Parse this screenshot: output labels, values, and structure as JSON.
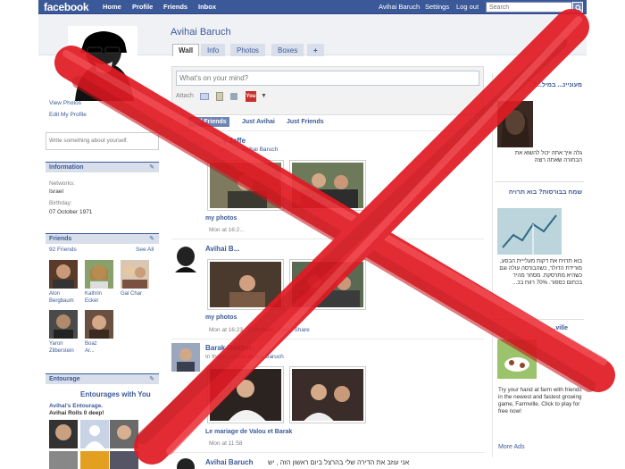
{
  "topbar": {
    "logo": "facebook",
    "nav": [
      "Home",
      "Profile",
      "Friends",
      "Inbox"
    ],
    "user": "Avihai Baruch",
    "settings": "Settings",
    "logout": "Log out",
    "search_placeholder": "Search"
  },
  "left": {
    "view_photos": "View Photos",
    "edit_profile": "Edit My Profile",
    "write_placeholder": "Write something about yourself.",
    "info": {
      "heading": "Information",
      "networks_label": "Networks:",
      "networks_value": "Israel",
      "birthday_label": "Birthday:",
      "birthday_value": "07 October 1971"
    },
    "friends": {
      "heading": "Friends",
      "count": "92 Friends",
      "see_all": "See All",
      "items": [
        {
          "first": "Alon",
          "last": "Bergbaum"
        },
        {
          "first": "Kathrin",
          "last": "Ecker"
        },
        {
          "first": "Gal Char",
          "last": ""
        },
        {
          "first": "Yaron",
          "last": "Zilberstein"
        },
        {
          "first": "Boaz",
          "last": "Ar..."
        }
      ]
    },
    "entourage": {
      "heading": "Entourage",
      "promo": "Entourages with You",
      "title": "Avihai's Entourage.",
      "subtitle": "Avihai Rolls 0 deep!"
    }
  },
  "main": {
    "name": "Avihai Baruch",
    "tabs": [
      "Wall",
      "Info",
      "Photos",
      "Boxes",
      "+"
    ],
    "status_placeholder": "What's on your mind?",
    "attach_label": "Attach",
    "filters": [
      "and Friends",
      "Just Avihai",
      "Just Friends"
    ],
    "posts": [
      {
        "author": "...y Jaffe",
        "tagged_prefix": "...photos:",
        "tagged_user": "Avihai Baruch",
        "caption": "my photos",
        "time": "Mon at 16:2..."
      },
      {
        "author": "Avihai B...",
        "caption": "my photos",
        "time": "Mon at 16:23",
        "comment": "Comment",
        "like": "Like",
        "share": "Share"
      },
      {
        "author": "Barak Holtzer",
        "tagged_prefix": "In these photos:",
        "tagged_user": "Avihai Baruch",
        "caption": "Le mariage de Valou et Barak",
        "time": "Mon at 11:58"
      },
      {
        "author": "Avihai Baruch",
        "text": "אני עוזב את הדירה שלי בהרצל ביום ראשון הזה , יש"
      }
    ]
  },
  "right": {
    "ad1_title": "מעוניינ... במיל...?",
    "ad1_text": "גלה איך אתה יכול להשוא את הבחורה שאתה רוצה",
    "ad2_title": "שמח בבורסות? בוא תרויח",
    "ad2_text": "בוא תרויח את דקות מעלייית הבפע, מורידת הדולר, כשהבורסה עולה וגם כשהיא מתרסקת. מסחר מהיר בכתום כספור. 70% רווח בכ...",
    "ad3_title": "...ville",
    "ad3_text": "Try your hand at farm with friends in the newest and fastest growing game, Farmville. Click to play for free now!",
    "more_ads": "More Ads"
  }
}
